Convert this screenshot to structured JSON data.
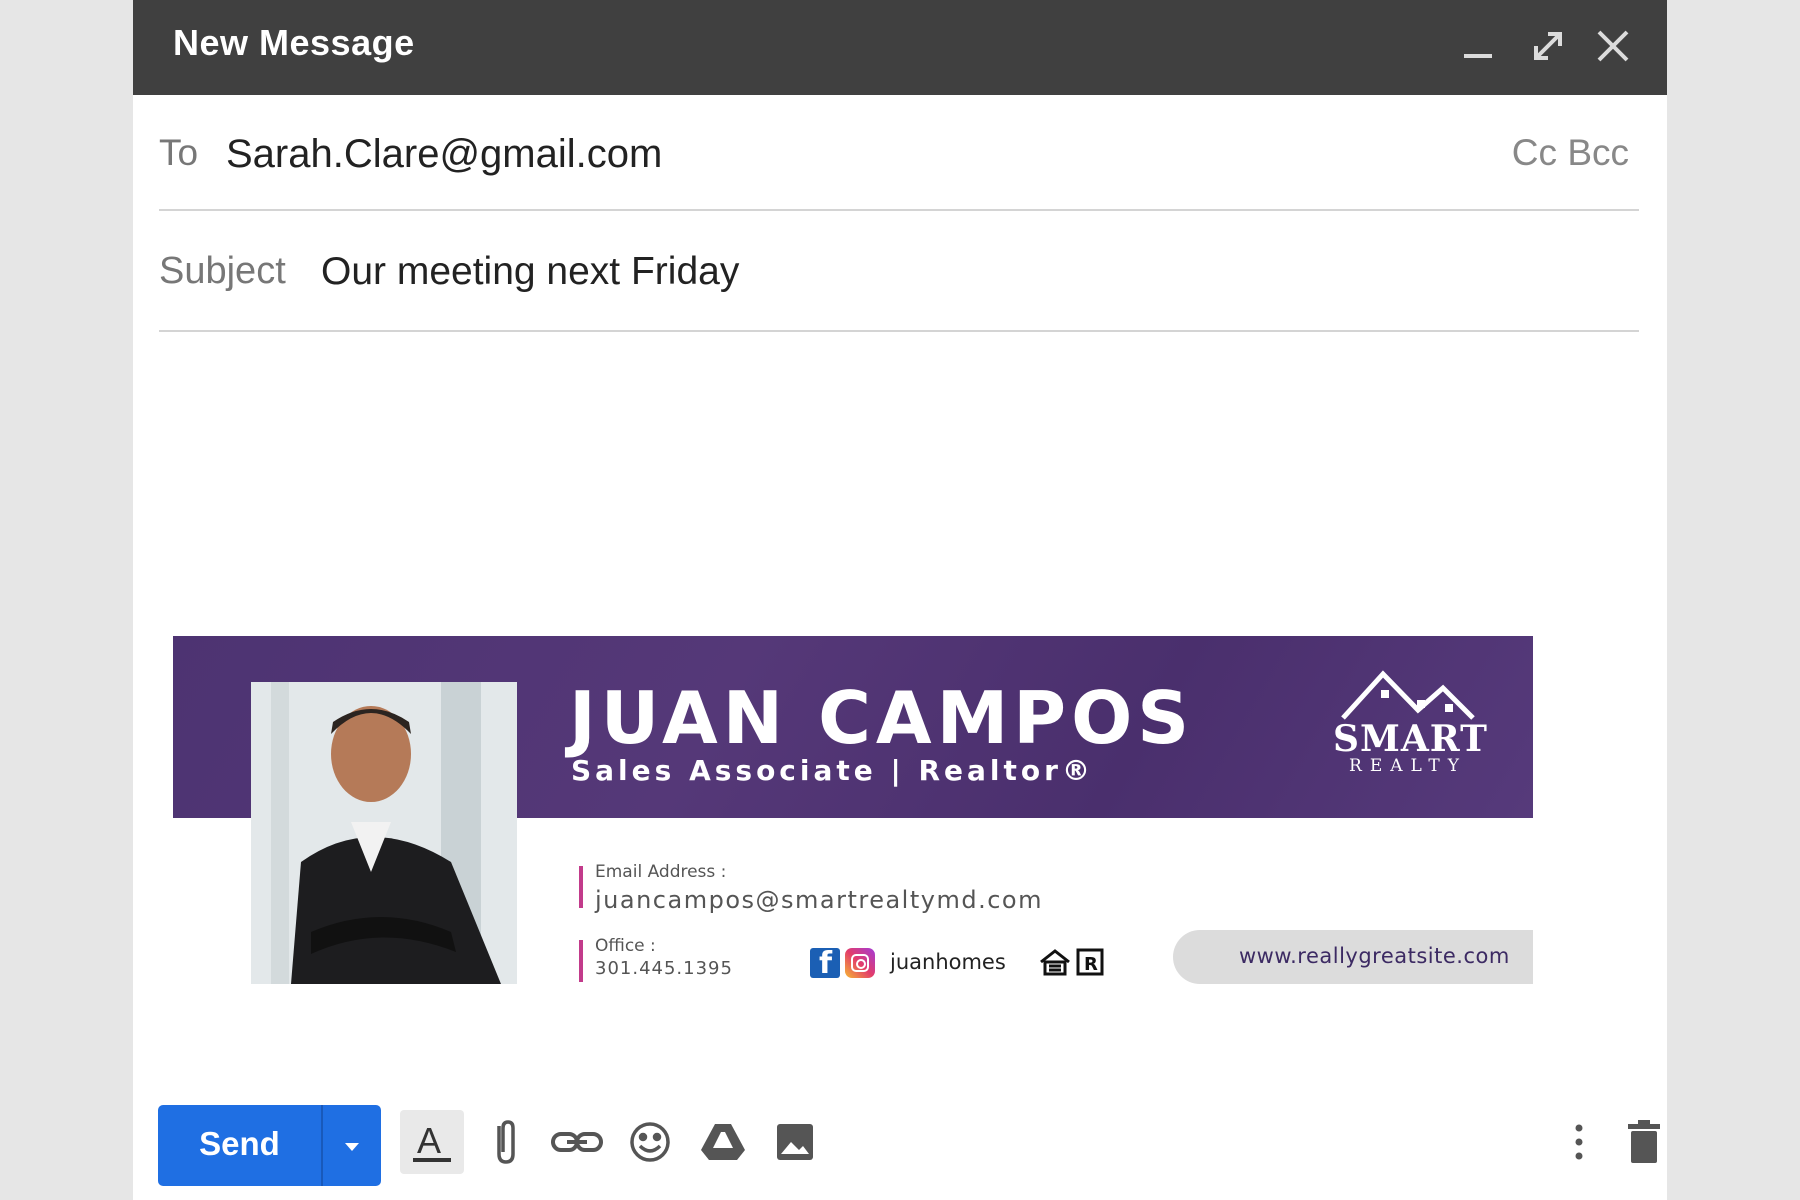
{
  "window": {
    "title": "New Message"
  },
  "recipients": {
    "to_label": "To",
    "to_value": "Sarah.Clare@gmail.com",
    "cc_label": "Cc",
    "bcc_label": "Bcc"
  },
  "subject": {
    "label": "Subject",
    "value": "Our meeting next Friday"
  },
  "signature": {
    "name": "JUAN CAMPOS",
    "role": "Sales Associate | Realtor®",
    "logo_line1": "SMART",
    "logo_line2": "REALTY",
    "email_label": "Email Address :",
    "email_value": "juancampos@smartrealtymd.com",
    "office_label": "Office  :",
    "office_value": "301.445.1395",
    "social_handle": "juanhomes",
    "website": "www.reallygreatsite.com",
    "colors": {
      "band": "#4d3372",
      "accent_bar": "#c23b8b",
      "website_text": "#3c2a63"
    }
  },
  "toolbar": {
    "send_label": "Send",
    "icons": [
      "formatting-icon",
      "attach-icon",
      "link-icon",
      "emoji-icon",
      "drive-icon",
      "photo-icon",
      "more-options-icon",
      "trash-icon"
    ],
    "send_color": "#1f6fe3"
  }
}
